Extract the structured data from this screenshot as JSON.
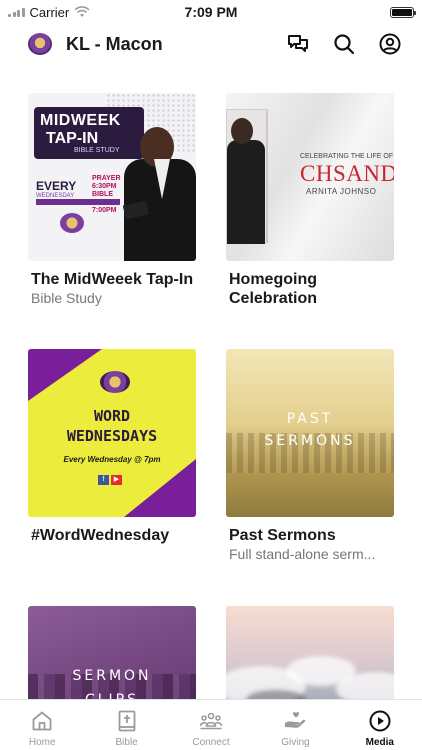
{
  "status_bar": {
    "carrier": "Carrier",
    "time": "7:09 PM"
  },
  "header": {
    "title": "KL - Macon",
    "icons": [
      "logo",
      "messages-icon",
      "search-icon",
      "profile-icon"
    ]
  },
  "cards": [
    {
      "title": "The MidWeeek Tap-In",
      "subtitle": "Bible Study",
      "thumb": {
        "line1": "MIDWEEK",
        "line2": "TAP-IN",
        "line3": "BIBLE STUDY",
        "every": "EVERY",
        "weekday": "WEDNESDAY",
        "times": "PRAYER 6:30PM BIBLE STUDY 7:00PM"
      }
    },
    {
      "title": "Homegoing Celebration",
      "subtitle": "",
      "thumb": {
        "line1": "CELEBRATING THE LIFE OF",
        "line2": "CHSAND",
        "line3": "ARNITA JOHNSO"
      }
    },
    {
      "title": "#WordWednesday",
      "subtitle": "",
      "thumb": {
        "line1": "WORD",
        "line2": "WEDNESDAYS",
        "line3": "Every Wednesday @ 7pm"
      }
    },
    {
      "title": "Past Sermons",
      "subtitle": "Full stand-alone serm...",
      "thumb": {
        "line1": "PAST",
        "line2": "SERMONS"
      }
    },
    {
      "title": "",
      "subtitle": "",
      "thumb": {
        "line1": "SERMON",
        "line2": "CLIPS"
      }
    },
    {
      "title": "",
      "subtitle": "",
      "thumb": {}
    }
  ],
  "tabs": [
    {
      "label": "Home",
      "icon": "home-icon",
      "active": false
    },
    {
      "label": "Bible",
      "icon": "bible-icon",
      "active": false
    },
    {
      "label": "Connect",
      "icon": "connect-icon",
      "active": false
    },
    {
      "label": "Giving",
      "icon": "giving-icon",
      "active": false
    },
    {
      "label": "Media",
      "icon": "media-icon",
      "active": true
    }
  ],
  "colors": {
    "accent_purple": "#7a1f9a",
    "accent_yellow": "#ecec3c",
    "active_tab": "#111111",
    "inactive_tab": "#9a9a9a"
  }
}
